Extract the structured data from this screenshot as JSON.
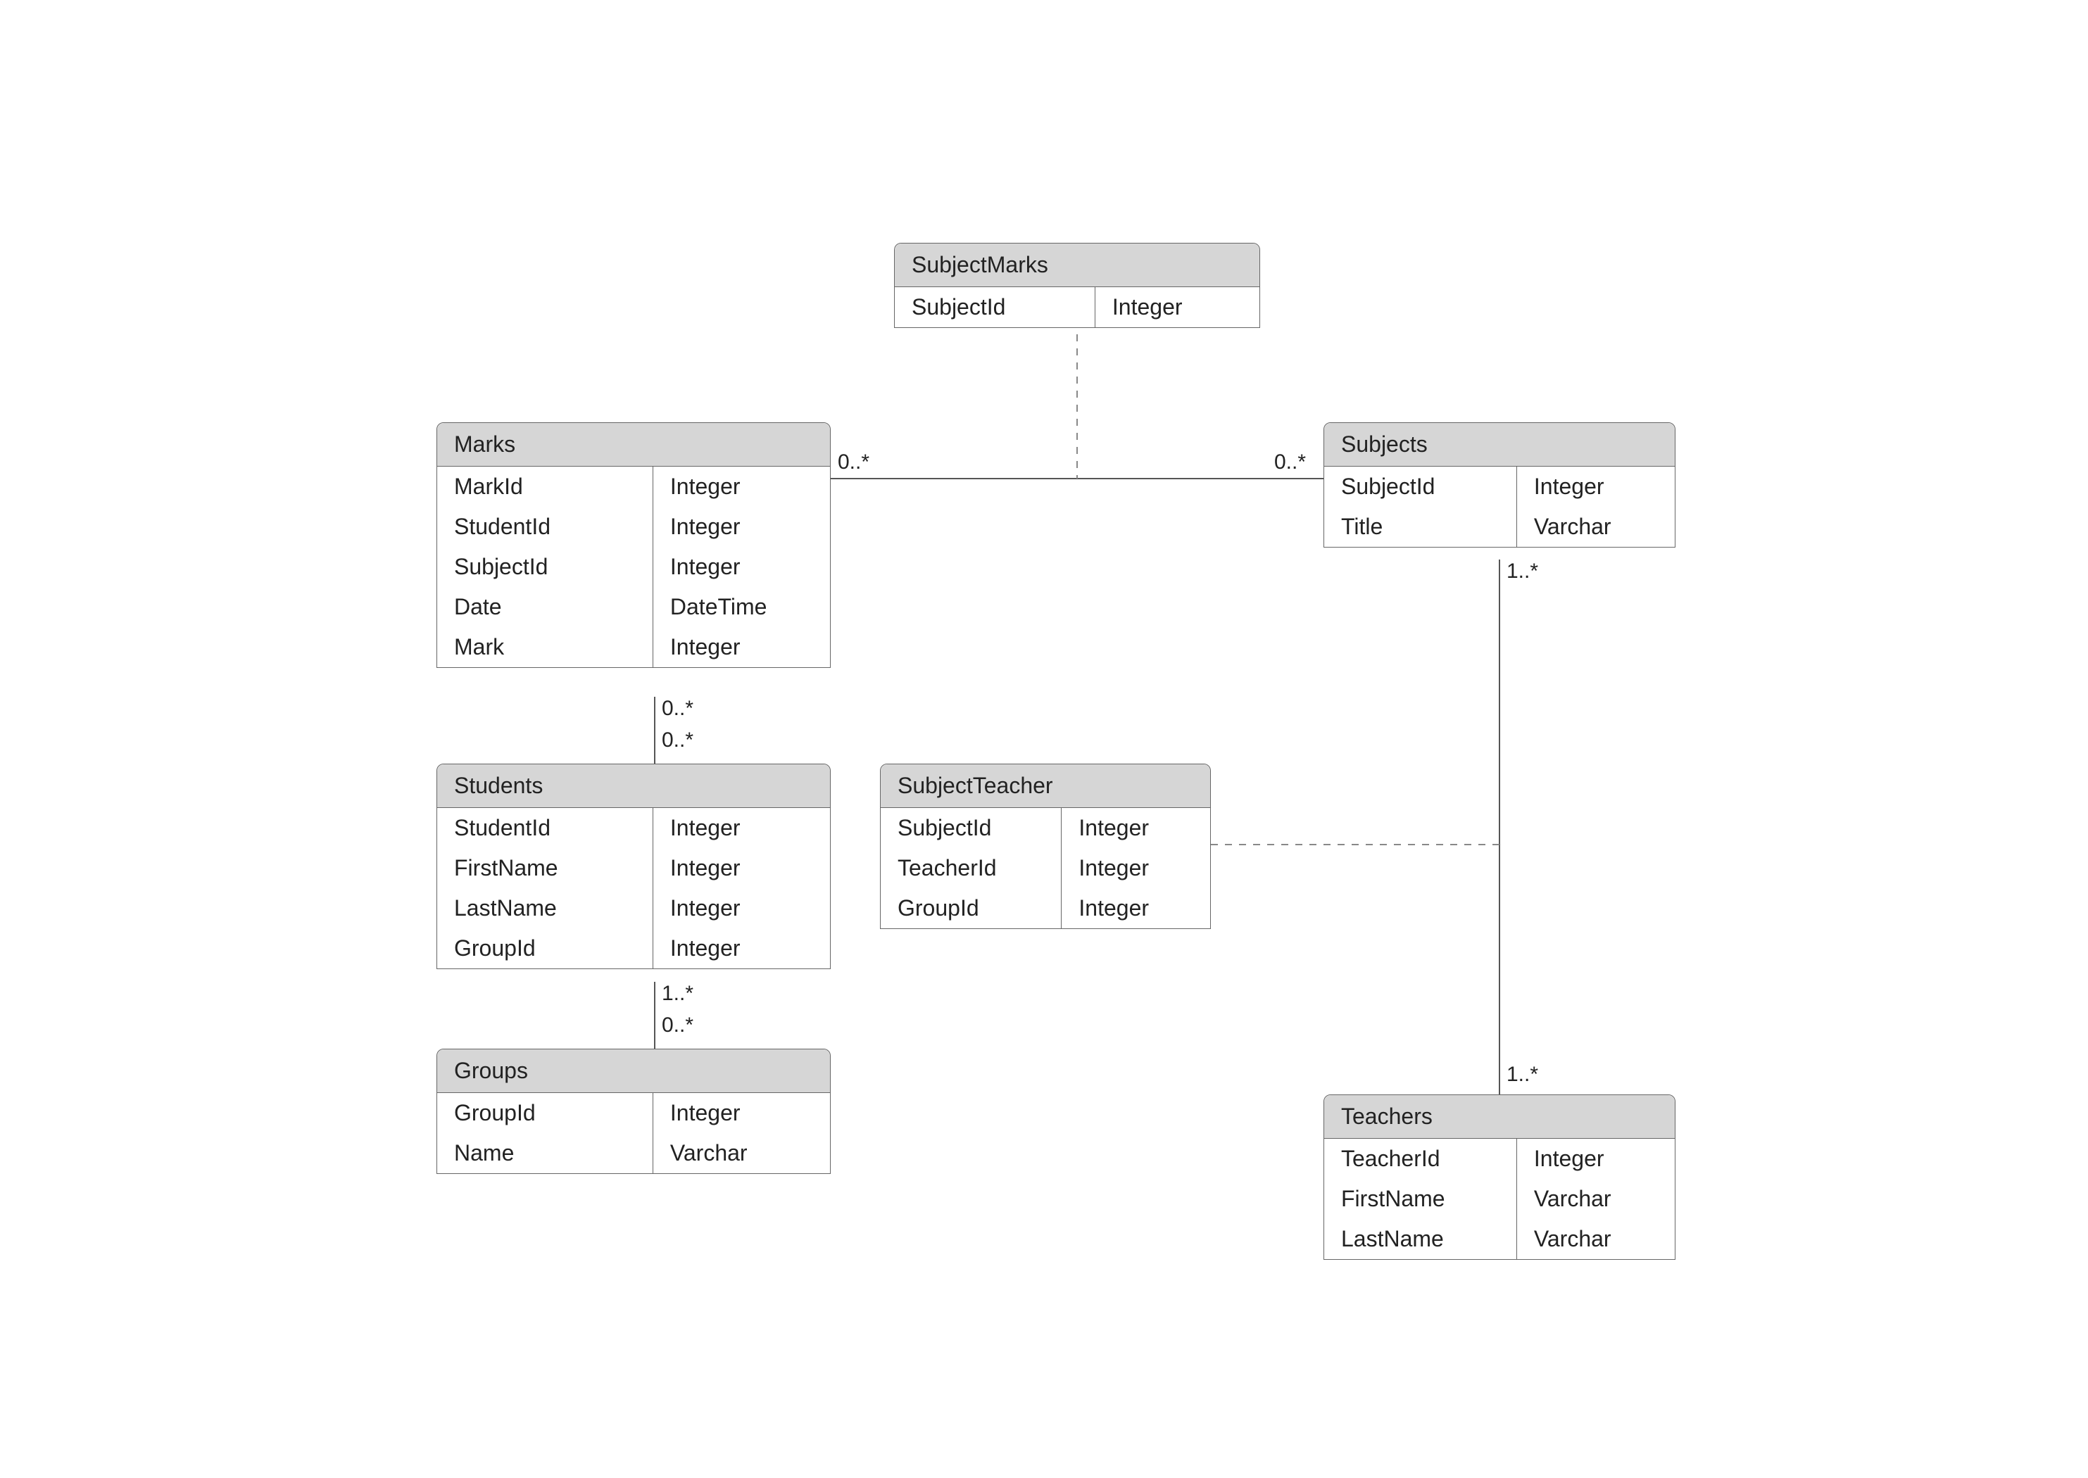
{
  "entities": {
    "subjectMarks": {
      "title": "SubjectMarks",
      "rows": [
        {
          "name": "SubjectId",
          "type": "Integer"
        }
      ]
    },
    "marks": {
      "title": "Marks",
      "rows": [
        {
          "name": "MarkId",
          "type": "Integer"
        },
        {
          "name": "StudentId",
          "type": "Integer"
        },
        {
          "name": "SubjectId",
          "type": "Integer"
        },
        {
          "name": "Date",
          "type": "DateTime"
        },
        {
          "name": "Mark",
          "type": "Integer"
        }
      ]
    },
    "subjects": {
      "title": "Subjects",
      "rows": [
        {
          "name": "SubjectId",
          "type": "Integer"
        },
        {
          "name": "Title",
          "type": "Varchar"
        }
      ]
    },
    "students": {
      "title": "Students",
      "rows": [
        {
          "name": "StudentId",
          "type": "Integer"
        },
        {
          "name": "FirstName",
          "type": "Integer"
        },
        {
          "name": "LastName",
          "type": "Integer"
        },
        {
          "name": "GroupId",
          "type": "Integer"
        }
      ]
    },
    "subjectTeacher": {
      "title": "SubjectTeacher",
      "rows": [
        {
          "name": "SubjectId",
          "type": "Integer"
        },
        {
          "name": "TeacherId",
          "type": "Integer"
        },
        {
          "name": "GroupId",
          "type": "Integer"
        }
      ]
    },
    "groups": {
      "title": "Groups",
      "rows": [
        {
          "name": "GroupId",
          "type": "Integer"
        },
        {
          "name": "Name",
          "type": "Varchar"
        }
      ]
    },
    "teachers": {
      "title": "Teachers",
      "rows": [
        {
          "name": "TeacherId",
          "type": "Integer"
        },
        {
          "name": "FirstName",
          "type": "Varchar"
        },
        {
          "name": "LastName",
          "type": "Varchar"
        }
      ]
    }
  },
  "multiplicities": {
    "marksSubjectsLeft": "0..*",
    "marksSubjectsRight": "0..*",
    "marksBottom": "0..*",
    "studentsTop": "0..*",
    "studentsBottom": "1..*",
    "groupsTop": "0..*",
    "subjectsBottom": "1..*",
    "teachersTop": "1..*"
  }
}
